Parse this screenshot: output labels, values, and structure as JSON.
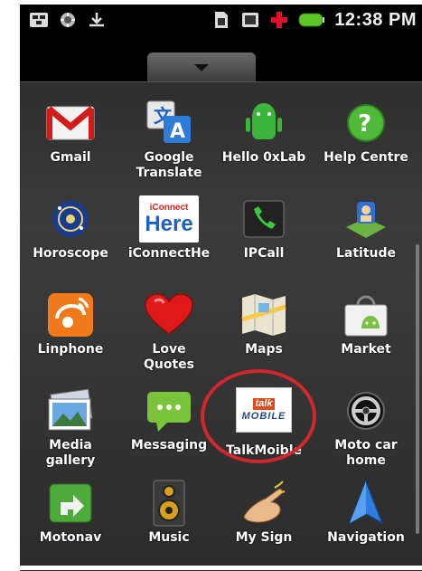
{
  "status_bar": {
    "time": "12:38 PM",
    "icons": [
      "usb-icon",
      "debug-icon",
      "download-icon",
      "sim-icon",
      "sd-card-icon",
      "medical-cross-icon",
      "battery-icon"
    ]
  },
  "drawer": {
    "handle_icon": "chevron-down-icon"
  },
  "apps": [
    {
      "id": "gmail",
      "label": "Gmail",
      "label2": ""
    },
    {
      "id": "google-translate",
      "label": "Google",
      "label2": "Translate"
    },
    {
      "id": "hello-0xlab",
      "label": "Hello 0xLab",
      "label2": ""
    },
    {
      "id": "help-centre",
      "label": "Help Centre",
      "label2": ""
    },
    {
      "id": "horoscope",
      "label": "Horoscope",
      "label2": ""
    },
    {
      "id": "iconnecthere",
      "label": "iConnectHe",
      "label2": ""
    },
    {
      "id": "ipcall",
      "label": "IPCall",
      "label2": ""
    },
    {
      "id": "latitude",
      "label": "Latitude",
      "label2": ""
    },
    {
      "id": "linphone",
      "label": "Linphone",
      "label2": ""
    },
    {
      "id": "love-quotes",
      "label": "Love",
      "label2": "Quotes"
    },
    {
      "id": "maps",
      "label": "Maps",
      "label2": ""
    },
    {
      "id": "market",
      "label": "Market",
      "label2": ""
    },
    {
      "id": "media-gallery",
      "label": "Media",
      "label2": "gallery"
    },
    {
      "id": "messaging",
      "label": "Messaging",
      "label2": ""
    },
    {
      "id": "talkmoible",
      "label": "TalkMoible",
      "label2": ""
    },
    {
      "id": "moto-car-home",
      "label": "Moto car",
      "label2": "home"
    },
    {
      "id": "motonav",
      "label": "Motonav",
      "label2": ""
    },
    {
      "id": "music",
      "label": "Music",
      "label2": ""
    },
    {
      "id": "my-sign",
      "label": "My Sign",
      "label2": ""
    },
    {
      "id": "navigation",
      "label": "Navigation",
      "label2": ""
    }
  ],
  "icon_text": {
    "iconnect_top": "iConnect",
    "iconnect_here": "Here",
    "talk_logo_top": "talk",
    "talk_logo_bottom": "MOBILE"
  },
  "colors": {
    "highlight_circle": "#d0282c",
    "drawer_bg": "#333333"
  }
}
